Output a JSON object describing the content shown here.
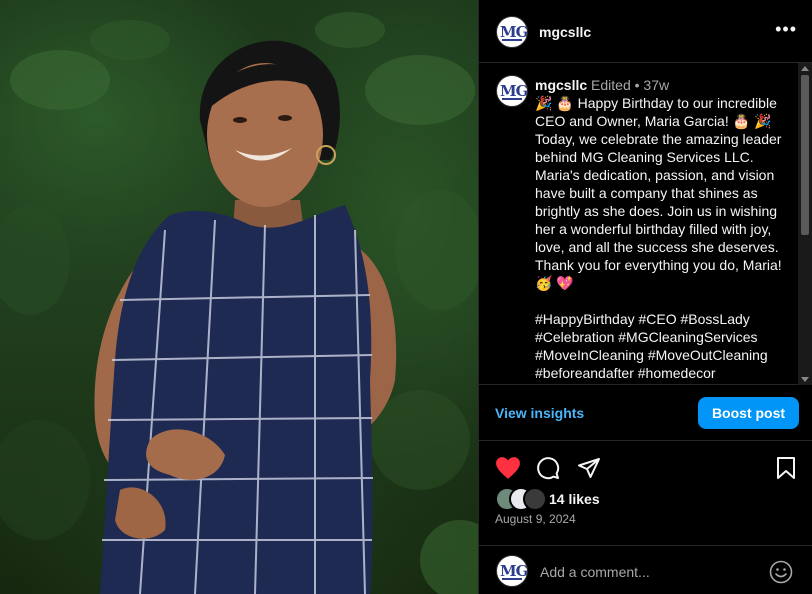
{
  "post": {
    "username": "mgcsllc",
    "avatar_text": "MG",
    "more_icon": "•••",
    "caption_edited": "Edited",
    "caption_separator": "•",
    "caption_age": "37w",
    "caption_body": "🎉 🎂 Happy Birthday to our incredible CEO and Owner, Maria Garcia! 🎂 🎉 Today, we celebrate the amazing leader behind MG Cleaning Services LLC. Maria's dedication, passion, and vision have built a company that shines as brightly as she does. Join us in wishing her a wonderful birthday filled with joy, love, and all the success she deserves. Thank you for everything you do, Maria! 🥳 💖",
    "hashtags": "#HappyBirthday #CEO #BossLady #Celebration #MGCleaningServices #MoveInCleaning #MoveOutCleaning #beforeandafter #homedecor",
    "view_insights": "View insights",
    "boost_post": "Boost post",
    "likes": "14 likes",
    "date": "August 9, 2024",
    "comment_placeholder": "Add a comment...",
    "liked": true,
    "colors": {
      "accent": "#0095f6",
      "link": "#4cb5f9",
      "like": "#ff3040"
    },
    "icons": [
      "heart-icon",
      "comment-icon",
      "share-icon",
      "bookmark-icon",
      "emoji-icon"
    ]
  }
}
